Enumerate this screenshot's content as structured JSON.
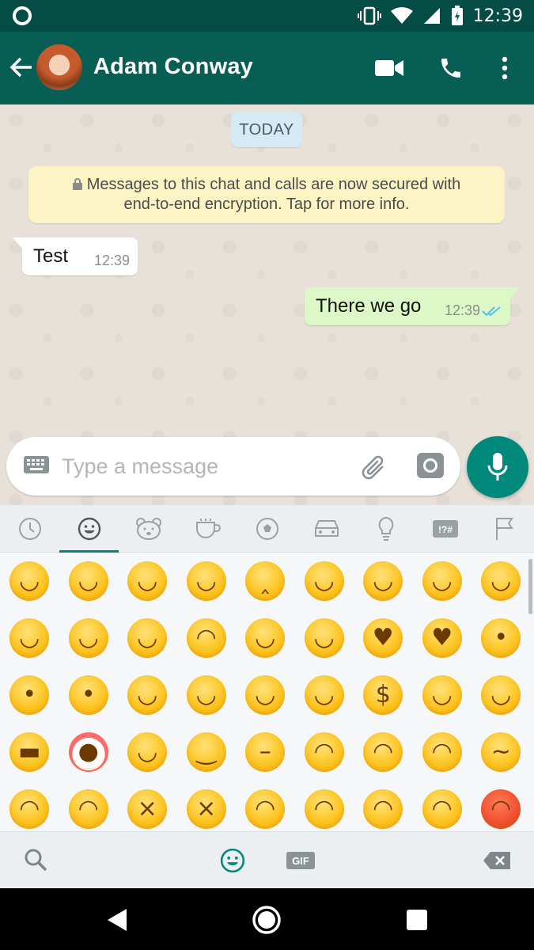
{
  "status_bar": {
    "time": "12:39"
  },
  "header": {
    "contact_name": "Adam Conway"
  },
  "chat": {
    "date_chip": "TODAY",
    "encryption_notice_line1": "Messages to this chat and calls are now secured with",
    "encryption_notice_line2": "end-to-end encryption. Tap for more info.",
    "messages": [
      {
        "direction": "incoming",
        "text": "Test",
        "time": "12:39"
      },
      {
        "direction": "outgoing",
        "text": "There we go",
        "time": "12:39",
        "status": "read"
      }
    ]
  },
  "composer": {
    "placeholder": "Type a message"
  },
  "emoji_panel": {
    "categories": [
      "recent",
      "smileys",
      "animals",
      "food",
      "activity",
      "travel",
      "objects",
      "symbols",
      "flags"
    ],
    "active_category": "smileys",
    "rows": [
      [
        "grinning",
        "smiley",
        "smile",
        "grin",
        "laughing",
        "sweat-smile",
        "joy",
        "rofl",
        "relaxed"
      ],
      [
        "blush",
        "innocent",
        "slight-smile",
        "upside-down",
        "wink",
        "relieved",
        "heart-eyes",
        "kissing-heart",
        "kissing"
      ],
      [
        "kissing-smiling-eyes",
        "kissing-closed-eyes",
        "yum",
        "stuck-out-tongue-winking",
        "stuck-out-tongue-closed-eyes",
        "stuck-out-tongue",
        "money-mouth",
        "hugging",
        "nerd"
      ],
      [
        "sunglasses",
        "clown",
        "cowboy",
        "smirk",
        "unamused",
        "disappointed",
        "pensive",
        "worried",
        "confused"
      ],
      [
        "slight-frown",
        "frowning",
        "persevere",
        "confounded",
        "tired",
        "weary",
        "triumph",
        "angry",
        "rage"
      ]
    ],
    "gif_label": "GIF"
  }
}
